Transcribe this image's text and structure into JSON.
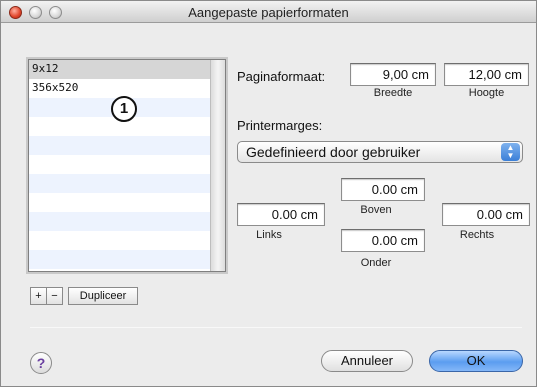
{
  "window": {
    "title": "Aangepaste papierformaten"
  },
  "annotation": {
    "marker": "1"
  },
  "paper_list": {
    "items": [
      "9x12",
      "356x520"
    ],
    "selected_index": 0,
    "buttons": {
      "add": "+",
      "remove": "−",
      "duplicate": "Dupliceer"
    }
  },
  "page_size": {
    "label": "Paginaformaat:",
    "width_value": "9,00 cm",
    "width_label": "Breedte",
    "height_value": "12,00 cm",
    "height_label": "Hoogte"
  },
  "margins": {
    "label": "Printermarges:",
    "preset": "Gedefinieerd door gebruiker",
    "top_value": "0.00 cm",
    "top_label": "Boven",
    "left_value": "0.00 cm",
    "left_label": "Links",
    "right_value": "0.00 cm",
    "right_label": "Rechts",
    "bottom_value": "0.00 cm",
    "bottom_label": "Onder"
  },
  "footer": {
    "help": "?",
    "cancel": "Annuleer",
    "ok": "OK"
  },
  "colors": {
    "default_button": "#5b9df0",
    "list_alt_row": "#edf3fe",
    "selection": "#d6d6d6"
  }
}
